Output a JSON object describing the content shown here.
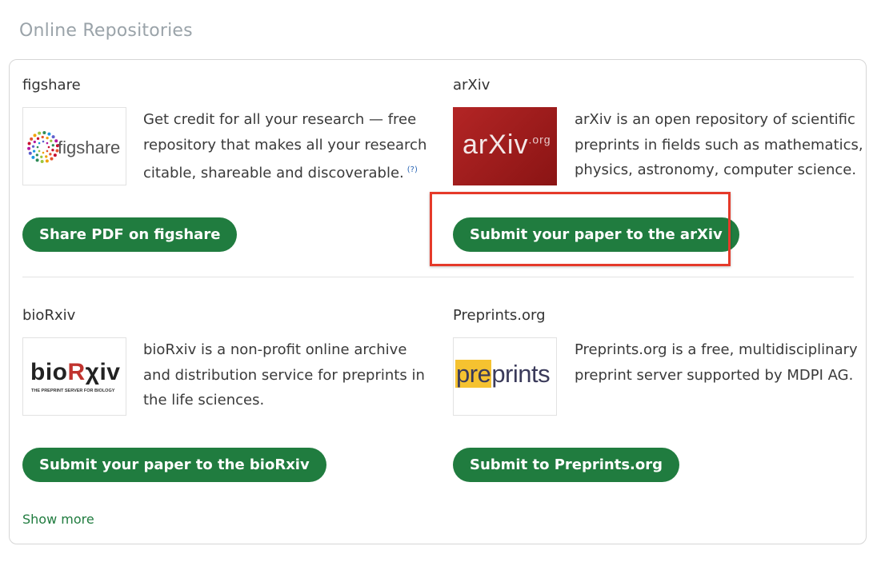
{
  "section": {
    "title": "Online Repositories"
  },
  "repos": [
    {
      "name": "figshare",
      "logo_text": "figshare",
      "description": [
        "Get credit for all your research — free",
        "repository that makes all your research",
        "citable, shareable and discoverable."
      ],
      "help_mark": "(?)",
      "button_label": "Share PDF on figshare"
    },
    {
      "name": "arXiv",
      "logo_text": "arXiv",
      "logo_suffix": ".org",
      "description": [
        "arXiv is an open repository of scientific",
        "preprints in fields such as mathematics,",
        "physics, astronomy, computer science."
      ],
      "button_label": "Submit your paper to the arXiv"
    },
    {
      "name": "bioRxiv",
      "logo_text_a": "bio",
      "logo_text_b": "R",
      "logo_text_c": "χiv",
      "logo_tagline": "THE PREPRINT SERVER FOR BIOLOGY",
      "description": [
        "bioRxiv is a non-profit online archive",
        "and distribution service for preprints in",
        "the life sciences."
      ],
      "button_label": "Submit your paper to the bioRxiv"
    },
    {
      "name": "Preprints.org",
      "logo_text_a": "pre",
      "logo_text_b": "prints",
      "description": [
        "Preprints.org is a free, multidisciplinary",
        "preprint server supported by MDPI AG."
      ],
      "button_label": "Submit to Preprints.org"
    }
  ],
  "footer": {
    "show_more_label": "Show more"
  },
  "colors": {
    "button_green": "#207c3f",
    "highlight_red": "#e53a2a",
    "arxiv_red": "#9b1b1b",
    "preprints_yellow": "#f5c230"
  }
}
